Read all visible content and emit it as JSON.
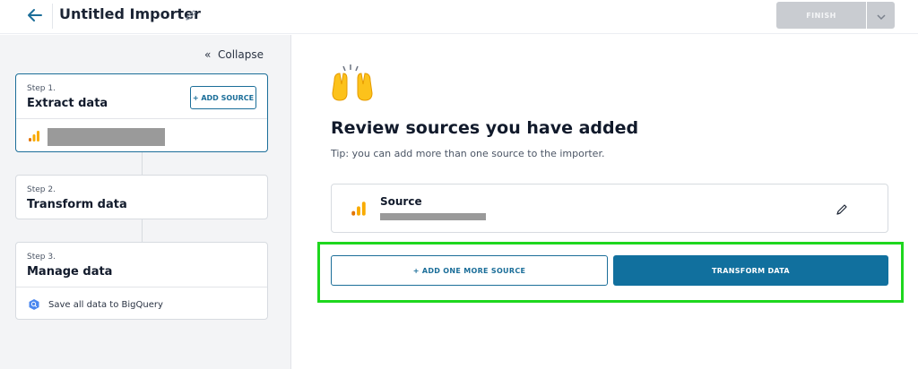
{
  "header": {
    "title": "Untitled Importer",
    "finish_label": "FINISH",
    "back_icon": "arrow-left-icon",
    "edit_icon": "pencil-icon",
    "dropdown_icon": "chevron-down-icon"
  },
  "sidebar": {
    "collapse_label": "Collapse",
    "collapse_icon": "double-chevron-left-icon",
    "steps": [
      {
        "step_label": "Step 1.",
        "title": "Extract data",
        "action_label": "+ ADD SOURCE",
        "source_icon": "google-analytics-icon"
      },
      {
        "step_label": "Step 2.",
        "title": "Transform data"
      },
      {
        "step_label": "Step 3.",
        "title": "Manage data",
        "destination_label": "Save all data to BigQuery",
        "destination_icon": "bigquery-icon"
      }
    ]
  },
  "main": {
    "emoji": "🙌",
    "heading": "Review sources you have added",
    "tip": "Tip: you can add more than one source to the importer.",
    "source_card": {
      "name": "Source",
      "icon": "google-analytics-icon",
      "edit_icon": "pencil-icon"
    },
    "add_more_label": "+ ADD ONE MORE SOURCE",
    "transform_label": "TRANSFORM DATA"
  },
  "colors": {
    "accent": "#11709e",
    "highlight": "#1ed71e",
    "disabled": "#c9ccd1"
  }
}
